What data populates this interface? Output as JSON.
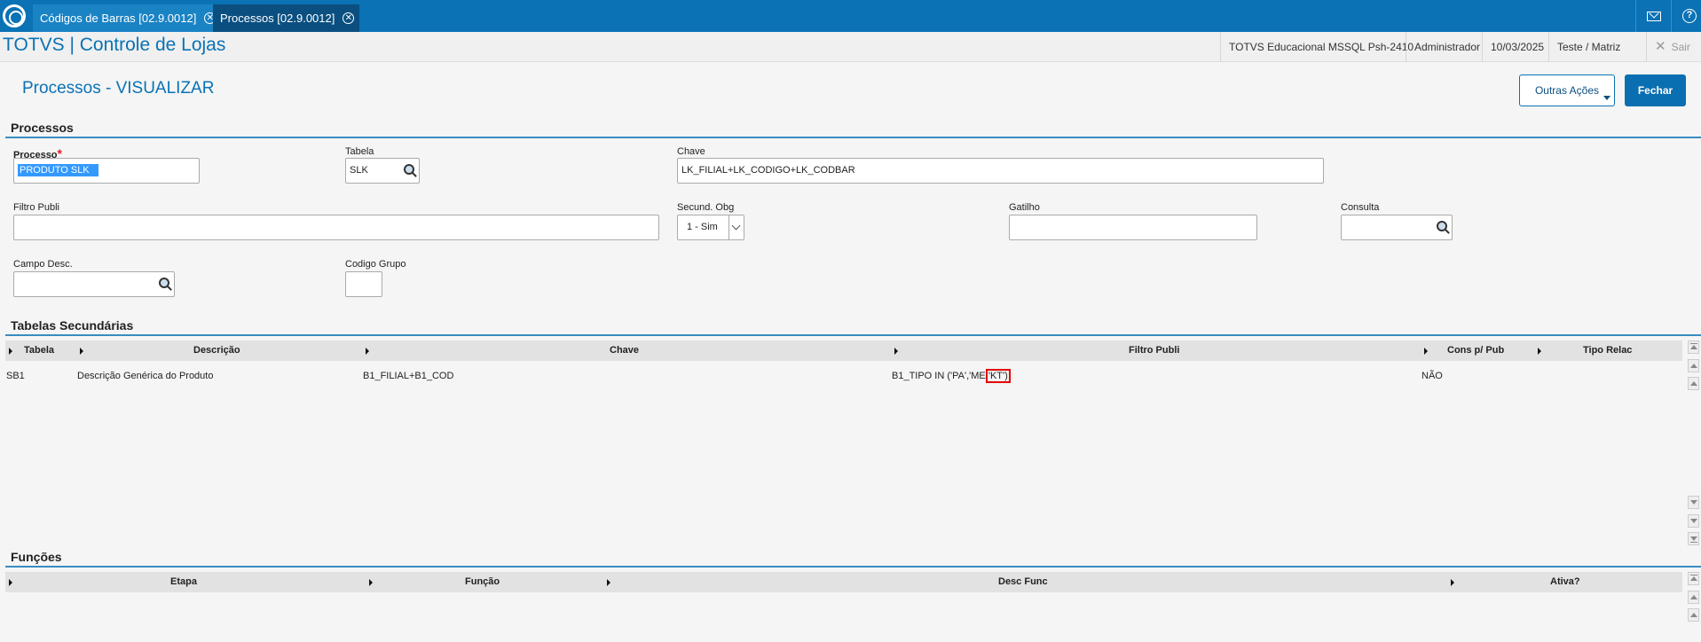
{
  "tabs": [
    {
      "label": "Códigos de Barras [02.9.0012]",
      "close": "✕"
    },
    {
      "label": "Processos [02.9.0012]",
      "close": "✕"
    }
  ],
  "header": {
    "app_title": "TOTVS | Controle de Lojas",
    "environment": "TOTVS Educacional MSSQL Psh-2410",
    "user": "Administrador",
    "date": "10/03/2025",
    "branch": "Teste / Matriz",
    "logout": "Sair"
  },
  "page": {
    "title": "Processos - VISUALIZAR",
    "other_actions": "Outras Ações",
    "close": "Fechar"
  },
  "processos": {
    "section_title": "Processos",
    "processo_label": "Processo",
    "processo_required": "*",
    "processo_value": "PRODUTO SLK",
    "tabela_label": "Tabela",
    "tabela_value": "SLK",
    "chave_label": "Chave",
    "chave_value": "LK_FILIAL+LK_CODIGO+LK_CODBAR",
    "filtro_label": "Filtro Publi",
    "filtro_value": "",
    "secund_label": "Secund. Obg",
    "secund_value": "1 - Sim",
    "gatilho_label": "Gatilho",
    "gatilho_value": "",
    "consulta_label": "Consulta",
    "consulta_value": "",
    "campo_desc_label": "Campo Desc.",
    "campo_desc_value": "",
    "codigo_grupo_label": "Codigo Grupo",
    "codigo_grupo_value": ""
  },
  "tabelas_secundarias": {
    "section_title": "Tabelas Secundárias",
    "columns": [
      "Tabela",
      "Descrição",
      "Chave",
      "Filtro Publi",
      "Cons p/ Pub",
      "Tipo Relac"
    ],
    "rows": [
      {
        "tabela": "SB1",
        "descricao": "Descrição Genérica do Produto",
        "chave": "B1_FILIAL+B1_COD",
        "filtro_prefix": "B1_TIPO IN ('PA','ME'",
        "filtro_highlight": "'KT')",
        "cons_pub": "NÃO",
        "tipo_relac": ""
      }
    ]
  },
  "funcoes": {
    "section_title": "Funções",
    "columns": [
      "Etapa",
      "Função",
      "Desc Func",
      "Ativa?"
    ]
  },
  "colors": {
    "accent": "#0a72b5",
    "highlight_border": "#e00000"
  }
}
